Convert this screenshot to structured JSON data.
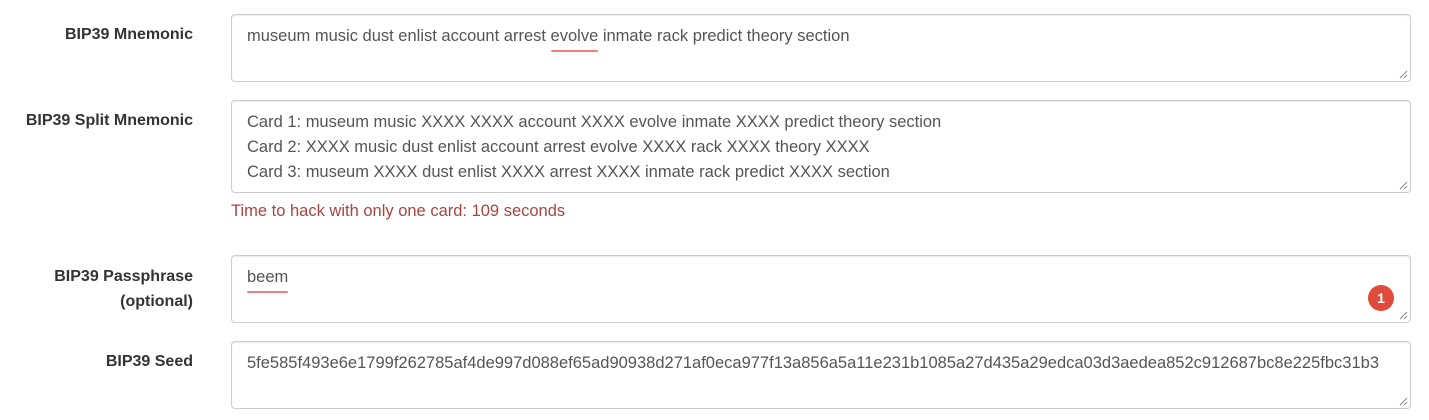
{
  "fields": {
    "mnemonic": {
      "label": "BIP39 Mnemonic",
      "words_before": "museum music dust enlist account arrest ",
      "misspelled": "evolve",
      "words_after": " inmate rack predict theory section"
    },
    "split_mnemonic": {
      "label": "BIP39 Split Mnemonic",
      "lines": [
        "Card 1: museum music XXXX XXXX account XXXX evolve inmate XXXX predict theory section",
        "Card 2: XXXX music dust enlist account arrest evolve XXXX rack XXXX theory XXXX",
        "Card 3: museum XXXX dust enlist XXXX arrest XXXX inmate rack predict XXXX section"
      ],
      "warning": "Time to hack with only one card: 109 seconds"
    },
    "passphrase": {
      "label_line1": "BIP39 Passphrase",
      "label_line2": "(optional)",
      "value": "beem",
      "badge_count": "1"
    },
    "seed": {
      "label": "BIP39 Seed",
      "value": "5fe585f493e6e1799f262785af4de997d088ef65ad90938d271af0eca977f13a856a5a11e231b1085a27d435a29edca03d3aedea852c912687bc8e225fbc31b3"
    }
  },
  "colors": {
    "error": "#a94442",
    "spellcheck_underline": "#f08080",
    "badge": "#e04b3c"
  }
}
